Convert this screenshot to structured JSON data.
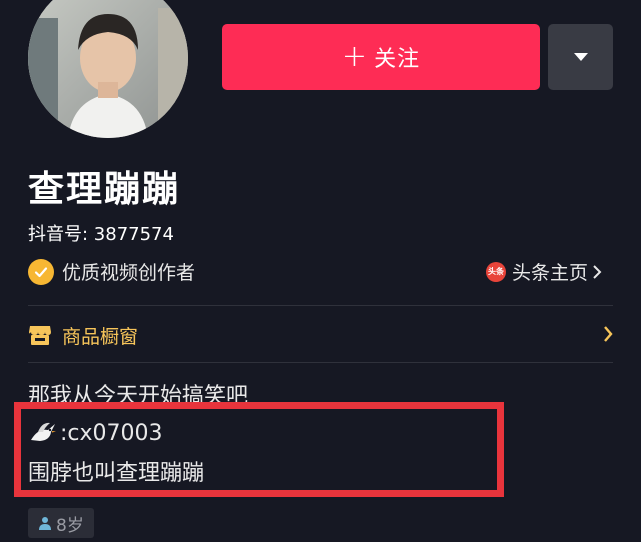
{
  "profile": {
    "nickname": "查理蹦蹦",
    "douyin_id": "抖音号: 3877574",
    "verified_label": "优质视频创作者",
    "toutiao_link_label": "头条主页",
    "toutiao_icon_text": "头条"
  },
  "actions": {
    "follow_plus": "+",
    "follow_label": "关注"
  },
  "shop": {
    "label": "商品橱窗"
  },
  "bio": {
    "line1": "那我从今天开始搞笑吧",
    "wechat": ":cx07003",
    "line3": "围脖也叫查理蹦蹦"
  },
  "tags": {
    "age": "8岁"
  },
  "icons": {
    "follow_icon": "plus-icon",
    "more": "triangle-down-icon",
    "verified": "check-badge-icon",
    "toutiao": "toutiao-logo-icon",
    "shop": "storefront-icon",
    "wechat_emoji": "dove-icon",
    "age": "person-icon"
  },
  "colors": {
    "background": "#161823",
    "follow_button": "#fe2c55",
    "more_button": "#393b44",
    "badge_gold": "#f7b733",
    "shop_text": "#f7c55a",
    "highlight_box": "#e8343c"
  }
}
